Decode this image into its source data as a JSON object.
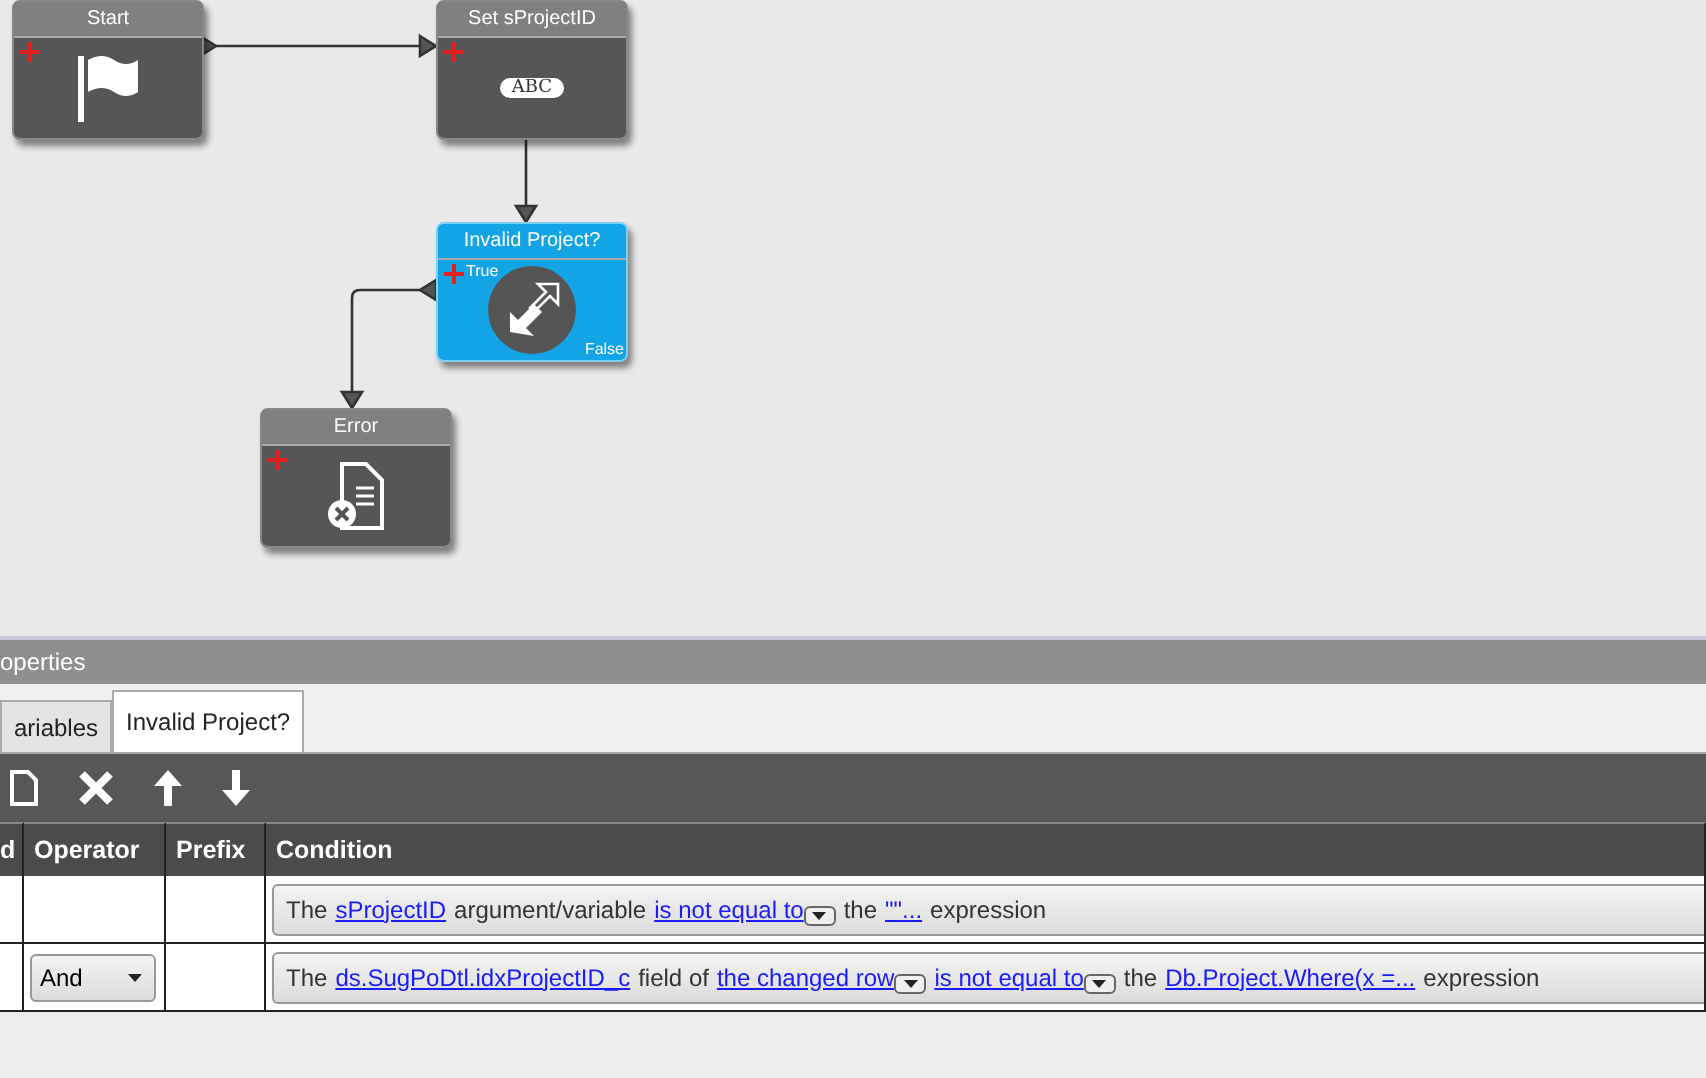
{
  "canvas": {
    "nodes": [
      {
        "kind": "start",
        "title": "Start",
        "selected": false
      },
      {
        "kind": "assign",
        "title": "Set sProjectID",
        "selected": false,
        "badge": "ABC"
      },
      {
        "kind": "condition",
        "title": "Invalid Project?",
        "selected": true,
        "true_label": "True",
        "false_label": "False"
      },
      {
        "kind": "error",
        "title": "Error",
        "selected": false
      }
    ]
  },
  "properties": {
    "title": "operties",
    "tabs": [
      {
        "label": "ariables",
        "selected": false
      },
      {
        "label": "Invalid Project?",
        "selected": true
      }
    ],
    "columns": [
      "d",
      "Operator",
      "Prefix",
      "Condition"
    ],
    "rows": [
      {
        "condition": [
          {
            "kind": "text",
            "text": "The"
          },
          {
            "kind": "link",
            "text": "sProjectID"
          },
          {
            "kind": "text",
            "text": "argument/variable"
          },
          {
            "kind": "link",
            "text": "is not equal to"
          },
          {
            "kind": "dropdown"
          },
          {
            "kind": "text",
            "text": "the"
          },
          {
            "kind": "link",
            "text": "\"\"..."
          },
          {
            "kind": "text",
            "text": "expression"
          }
        ]
      },
      {
        "operator": "And",
        "condition": [
          {
            "kind": "text",
            "text": "The"
          },
          {
            "kind": "link",
            "text": "ds.SugPoDtl.idxProjectID_c"
          },
          {
            "kind": "text",
            "text": "field of"
          },
          {
            "kind": "link",
            "text": "the changed row"
          },
          {
            "kind": "dropdown"
          },
          {
            "kind": "link",
            "text": "is not equal to"
          },
          {
            "kind": "dropdown"
          },
          {
            "kind": "text",
            "text": "the"
          },
          {
            "kind": "link",
            "text": "Db.Project.Where(x =..."
          },
          {
            "kind": "text",
            "text": "expression"
          }
        ]
      }
    ]
  }
}
